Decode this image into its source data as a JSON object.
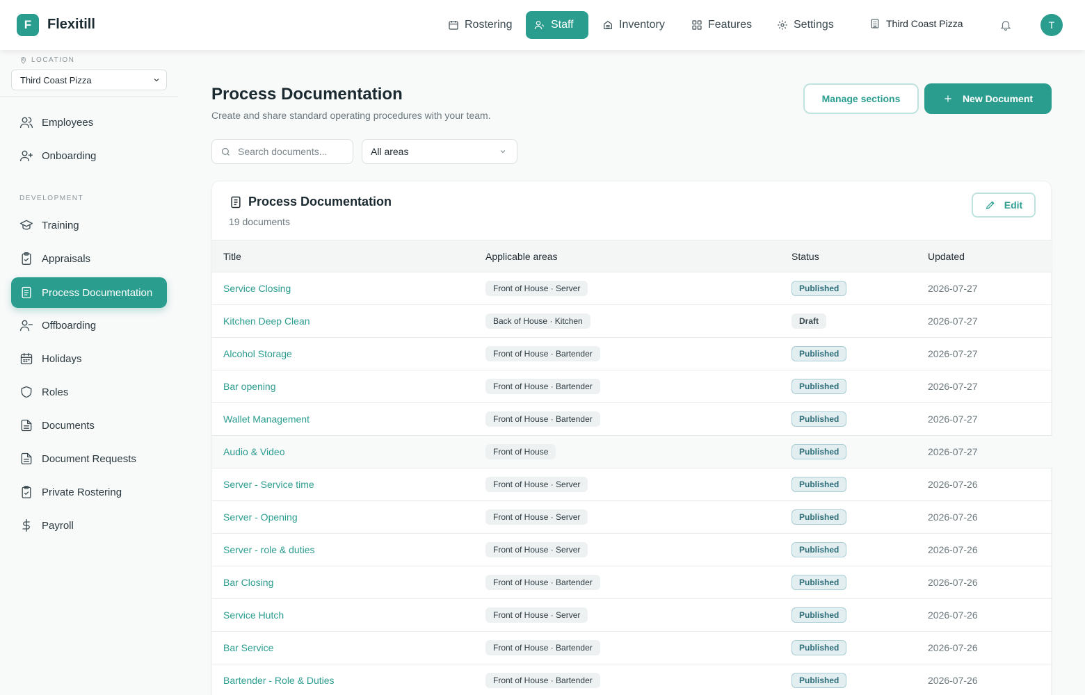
{
  "app": {
    "logo_letter": "F",
    "name": "Flexitill"
  },
  "nav": {
    "items": [
      {
        "label": "Rostering",
        "icon": "calendar-icon"
      },
      {
        "label": "Staff",
        "icon": "users-icon",
        "active": true
      },
      {
        "label": "Inventory",
        "icon": "archive-icon"
      },
      {
        "label": "Features",
        "icon": "grid-icon"
      },
      {
        "label": "Settings",
        "icon": "gear-icon"
      }
    ],
    "location": "Third Coast Pizza",
    "avatar_initial": "T"
  },
  "sidebar": {
    "location_label": "LOCATION",
    "location_value": "Third Coast Pizza",
    "section_development": "DEVELOPMENT",
    "items": [
      {
        "label": "Employees",
        "icon": "users-icon"
      },
      {
        "label": "Onboarding",
        "icon": "user-plus-icon"
      },
      {
        "label": "Training",
        "icon": "graduation-cap-icon"
      },
      {
        "label": "Appraisals",
        "icon": "clipboard-check-icon"
      },
      {
        "label": "Process Documentation",
        "icon": "document-icon",
        "active": true
      },
      {
        "label": "Offboarding",
        "icon": "user-minus-icon"
      },
      {
        "label": "Holidays",
        "icon": "calendar-days-icon"
      },
      {
        "label": "Roles",
        "icon": "shield-icon"
      },
      {
        "label": "Documents",
        "icon": "file-text-icon"
      },
      {
        "label": "Document Requests",
        "icon": "file-text-icon"
      },
      {
        "label": "Private Rostering",
        "icon": "clipboard-check-icon"
      },
      {
        "label": "Payroll",
        "icon": "dollar-icon"
      }
    ]
  },
  "main": {
    "title": "Process Documentation",
    "subtitle": "Create and share standard operating procedures with your team.",
    "manage_sections_label": "Manage sections",
    "new_document_label": "New Document",
    "search_placeholder": "Search documents...",
    "filter_value": "All areas",
    "card": {
      "title": "Process Documentation",
      "count": "19 documents",
      "edit_label": "Edit"
    },
    "table": {
      "headers": [
        "Title",
        "Applicable areas",
        "Status",
        "Updated"
      ],
      "rows": [
        {
          "title": "Service Closing",
          "area": "Front of House · Server",
          "status": "Published",
          "updated": "2026-07-27"
        },
        {
          "title": "Kitchen Deep Clean",
          "area": "Back of House · Kitchen",
          "status": "Draft",
          "updated": "2026-07-27"
        },
        {
          "title": "Alcohol Storage",
          "area": "Front of House · Bartender",
          "status": "Published",
          "updated": "2026-07-27"
        },
        {
          "title": "Bar opening",
          "area": "Front of House · Bartender",
          "status": "Published",
          "updated": "2026-07-27"
        },
        {
          "title": "Wallet Management",
          "area": "Front of House · Bartender",
          "status": "Published",
          "updated": "2026-07-27"
        },
        {
          "title": "Audio & Video",
          "area": "Front of House",
          "status": "Published",
          "updated": "2026-07-27"
        },
        {
          "title": "Server - Service time",
          "area": "Front of House · Server",
          "status": "Published",
          "updated": "2026-07-26"
        },
        {
          "title": "Server - Opening",
          "area": "Front of House · Server",
          "status": "Published",
          "updated": "2026-07-26"
        },
        {
          "title": "Server - role & duties",
          "area": "Front of House · Server",
          "status": "Published",
          "updated": "2026-07-26"
        },
        {
          "title": "Bar Closing",
          "area": "Front of House · Bartender",
          "status": "Published",
          "updated": "2026-07-26"
        },
        {
          "title": "Service Hutch",
          "area": "Front of House · Server",
          "status": "Published",
          "updated": "2026-07-26"
        },
        {
          "title": "Bar Service",
          "area": "Front of House · Bartender",
          "status": "Published",
          "updated": "2026-07-26"
        },
        {
          "title": "Bartender - Role & Duties",
          "area": "Front of House · Bartender",
          "status": "Published",
          "updated": "2026-07-26"
        }
      ]
    }
  },
  "colors": {
    "accent": "#2a9d8f",
    "published_bg": "#e3eef1",
    "published_text": "#2f6f7a"
  }
}
